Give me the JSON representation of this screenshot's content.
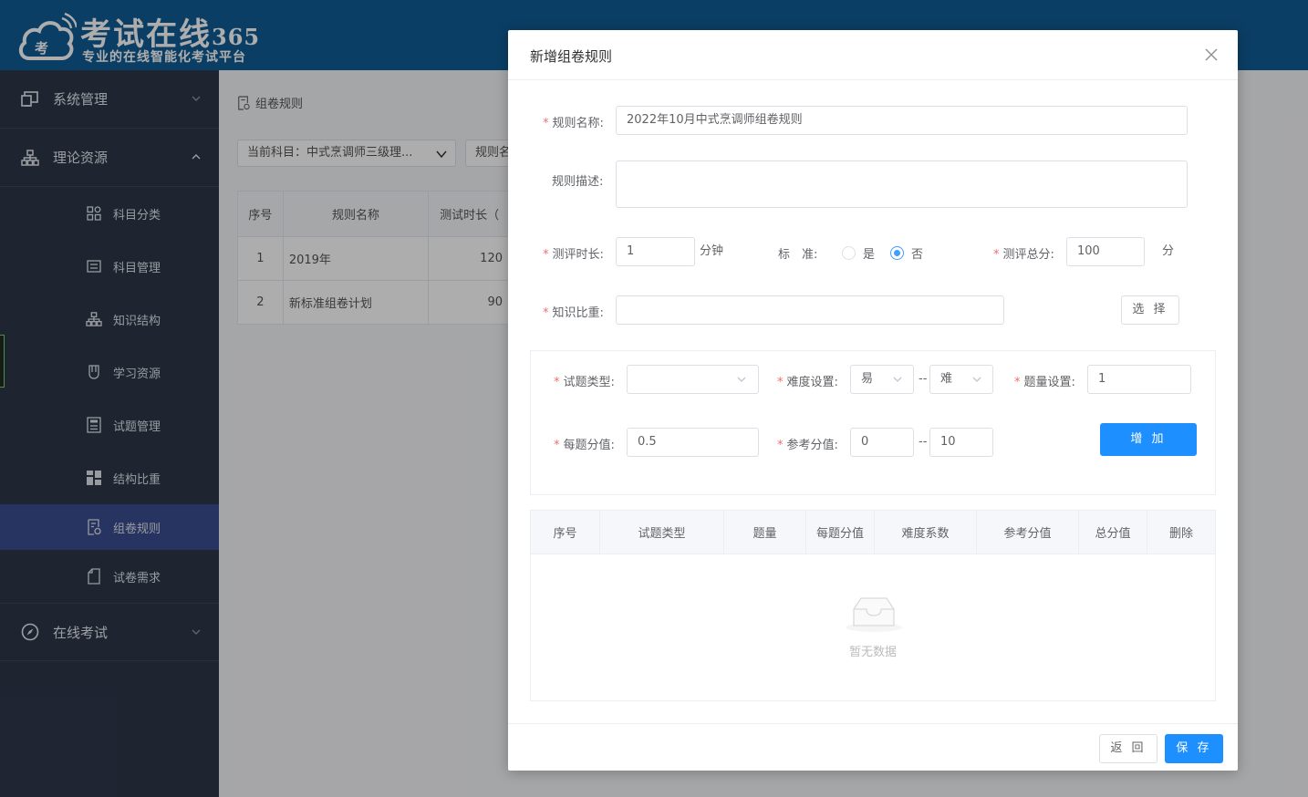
{
  "brand": {
    "logo_badge": "考",
    "name": "考试在线",
    "number": "365",
    "slogan": "专业的在线智能化考试平台"
  },
  "sidebar": {
    "groups": [
      {
        "label": "系统管理",
        "icon": "monitor-icon"
      },
      {
        "label": "理论资源",
        "icon": "sitemap-icon"
      },
      {
        "label": "在线考试",
        "icon": "compass-icon"
      }
    ],
    "items": [
      {
        "label": "科目分类",
        "icon": "grid-icon"
      },
      {
        "label": "科目管理",
        "icon": "list-icon"
      },
      {
        "label": "知识结构",
        "icon": "sitemap-icon"
      },
      {
        "label": "学习资源",
        "icon": "bookmark-icon"
      },
      {
        "label": "试题管理",
        "icon": "calculator-icon"
      },
      {
        "label": "结构比重",
        "icon": "tiles-icon"
      },
      {
        "label": "组卷规则",
        "icon": "rule-icon"
      },
      {
        "label": "试卷需求",
        "icon": "document-icon"
      }
    ],
    "active_item": "组卷规则"
  },
  "main": {
    "breadcrumb": "组卷规则",
    "subject_select": "当前科目：中式烹调师三级理...",
    "rule_filter": "规则名",
    "table": {
      "headers": [
        "序号",
        "规则名称",
        "测试时长（"
      ],
      "rows": [
        [
          "1",
          "2019年",
          "120"
        ],
        [
          "2",
          "新标准组卷计划",
          "90"
        ]
      ]
    }
  },
  "modal": {
    "title": "新增组卷规则",
    "rule_name": {
      "label": "规则名称:",
      "value": "2022年10月中式烹调师组卷规则"
    },
    "rule_desc": {
      "label": "规则描述:",
      "value": ""
    },
    "duration": {
      "label": "测评时长:",
      "value": "1",
      "unit": "分钟"
    },
    "standard": {
      "label": "标　准:",
      "options": [
        "是",
        "否"
      ],
      "selected": "否"
    },
    "total_score": {
      "label": "测评总分:",
      "value": "100",
      "unit": "分"
    },
    "knowledge": {
      "label": "知识比重:",
      "value": "",
      "button": "选 择"
    },
    "question_type": {
      "label": "试题类型:",
      "value": ""
    },
    "difficulty": {
      "label": "难度设置:",
      "from": "易",
      "separator": "--",
      "to": "难"
    },
    "quantity": {
      "label": "题量设置:",
      "value": "1"
    },
    "per_score": {
      "label": "每题分值:",
      "value": "0.5"
    },
    "ref_score": {
      "label": "参考分值:",
      "from": "0",
      "separator": "--",
      "to": "10"
    },
    "add_button": "增 加",
    "rules_table": {
      "headers": [
        "序号",
        "试题类型",
        "题量",
        "每题分值",
        "难度系数",
        "参考分值",
        "总分值",
        "删除"
      ],
      "empty_text": "暂无数据"
    },
    "back_button": "返 回",
    "save_button": "保 存"
  },
  "colors": {
    "header_bg": "#0f5c94",
    "sidebar_bg": "#2d3749",
    "sidebar_active": "#3a4c8e",
    "primary": "#1e8fff",
    "required": "#f56c6c"
  }
}
